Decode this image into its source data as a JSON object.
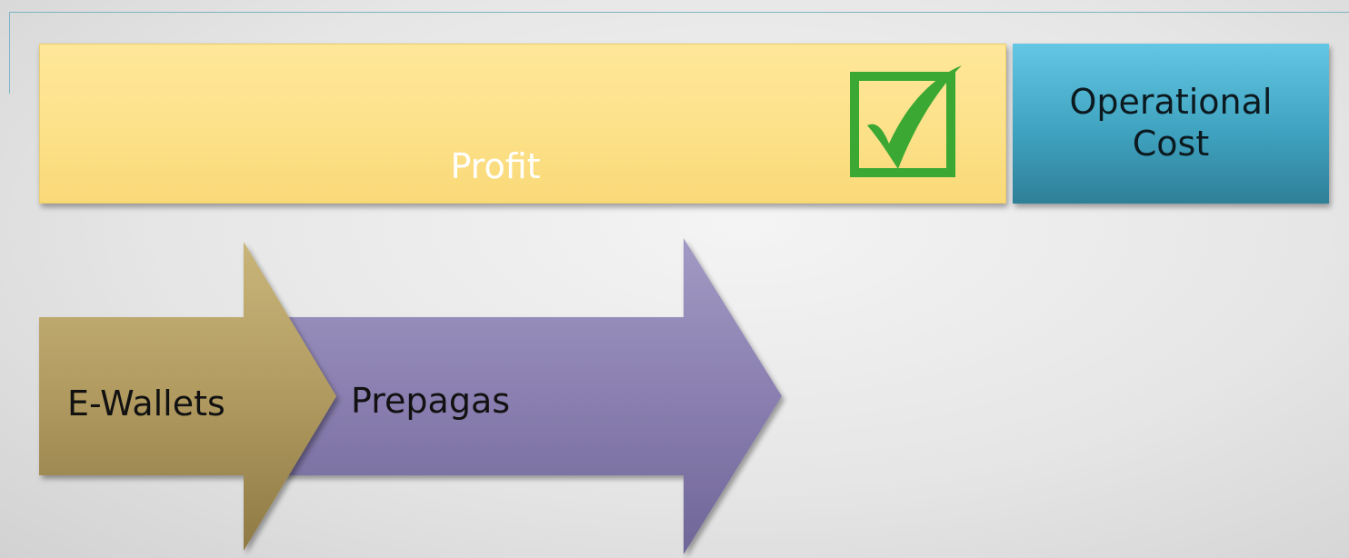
{
  "top_row": {
    "profit_label": "Profit",
    "operational_cost_label": "Operational\nCost",
    "checkbox_icon": "checked-checkbox-icon",
    "checkbox_color": "#3aa832"
  },
  "arrows": {
    "first_label": "E-Wallets",
    "second_label": "Prepagas",
    "first_color": "#b09a60",
    "second_color": "#8a7fb0"
  },
  "colors": {
    "profit_fill": "#fde28b",
    "operational_cost_fill": "#3fa3c0"
  }
}
